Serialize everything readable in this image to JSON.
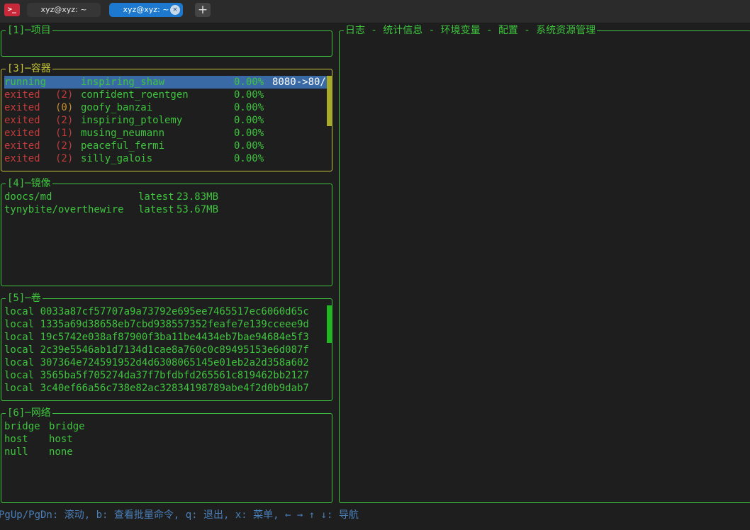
{
  "tabbar": {
    "app_icon": ">_",
    "tabs": [
      {
        "title": "xyz@xyz: ~"
      },
      {
        "title": "xyz@xyz: ~",
        "close": "×"
      }
    ],
    "new_tab": "+"
  },
  "panels": {
    "projects": {
      "title": "[1]─项目"
    },
    "containers": {
      "title": "[3]─容器",
      "rows": [
        {
          "state": "running",
          "code": "",
          "name": "inspiring_shaw",
          "cpu": "0.00%",
          "ports": "8080->80/"
        },
        {
          "state": "exited",
          "code": "(2)",
          "name": "confident_roentgen",
          "cpu": "0.00%",
          "ports": ""
        },
        {
          "state": "exited",
          "code": "(0)",
          "name": "goofy_banzai",
          "cpu": "0.00%",
          "ports": ""
        },
        {
          "state": "exited",
          "code": "(2)",
          "name": "inspiring_ptolemy",
          "cpu": "0.00%",
          "ports": ""
        },
        {
          "state": "exited",
          "code": "(1)",
          "name": "musing_neumann",
          "cpu": "0.00%",
          "ports": ""
        },
        {
          "state": "exited",
          "code": "(2)",
          "name": "peaceful_fermi",
          "cpu": "0.00%",
          "ports": ""
        },
        {
          "state": "exited",
          "code": "(2)",
          "name": "silly_galois",
          "cpu": "0.00%",
          "ports": ""
        }
      ]
    },
    "images": {
      "title": "[4]─镜像",
      "rows": [
        {
          "name": "doocs/md",
          "tag": "latest",
          "size": "23.83MB"
        },
        {
          "name": "tynybite/overthewire",
          "tag": "latest",
          "size": "53.67MB"
        }
      ]
    },
    "volumes": {
      "title": "[5]─卷",
      "rows": [
        "local 0033a87cf57707a9a73792e695ee7465517ec6060d65c",
        "local 1335a69d38658eb7cbd938557352feafe7e139cceee9d",
        "local 19c5742e038af87900f3ba11be4434eb7bae94684e5f3",
        "local 2c39e5546ab1d7134d1cae8a760c0c89495153e6d087f",
        "local 307364e724591952d4d6308065145e01eb2a2d358a602",
        "local 3565ba5f705274da37f7bfdbfd265561c819462bb2127",
        "local 3c40ef66a56c738e82ac32834198789abe4f2d0b9dab7"
      ]
    },
    "networks": {
      "title": "[6]─网络",
      "rows": [
        {
          "name": "bridge",
          "driver": "bridge"
        },
        {
          "name": "host",
          "driver": "host"
        },
        {
          "name": "null",
          "driver": "none"
        }
      ]
    },
    "main": {
      "title": "日志 - 统计信息 - 环境变量 - 配置 - 系统资源管理"
    }
  },
  "footer": {
    "help": "PgUp/PgDn: 滚动, b: 查看批量命令, q: 退出, x: 菜单, ← → ↑ ↓: 导航"
  },
  "colors": {
    "border": "#3ec43e",
    "active_border": "#c8c837",
    "selection": "#3a6aa6",
    "exited": "#c53a3a",
    "exit_code_zero": "#c88f2b",
    "footer_text": "#4a7fb8"
  }
}
